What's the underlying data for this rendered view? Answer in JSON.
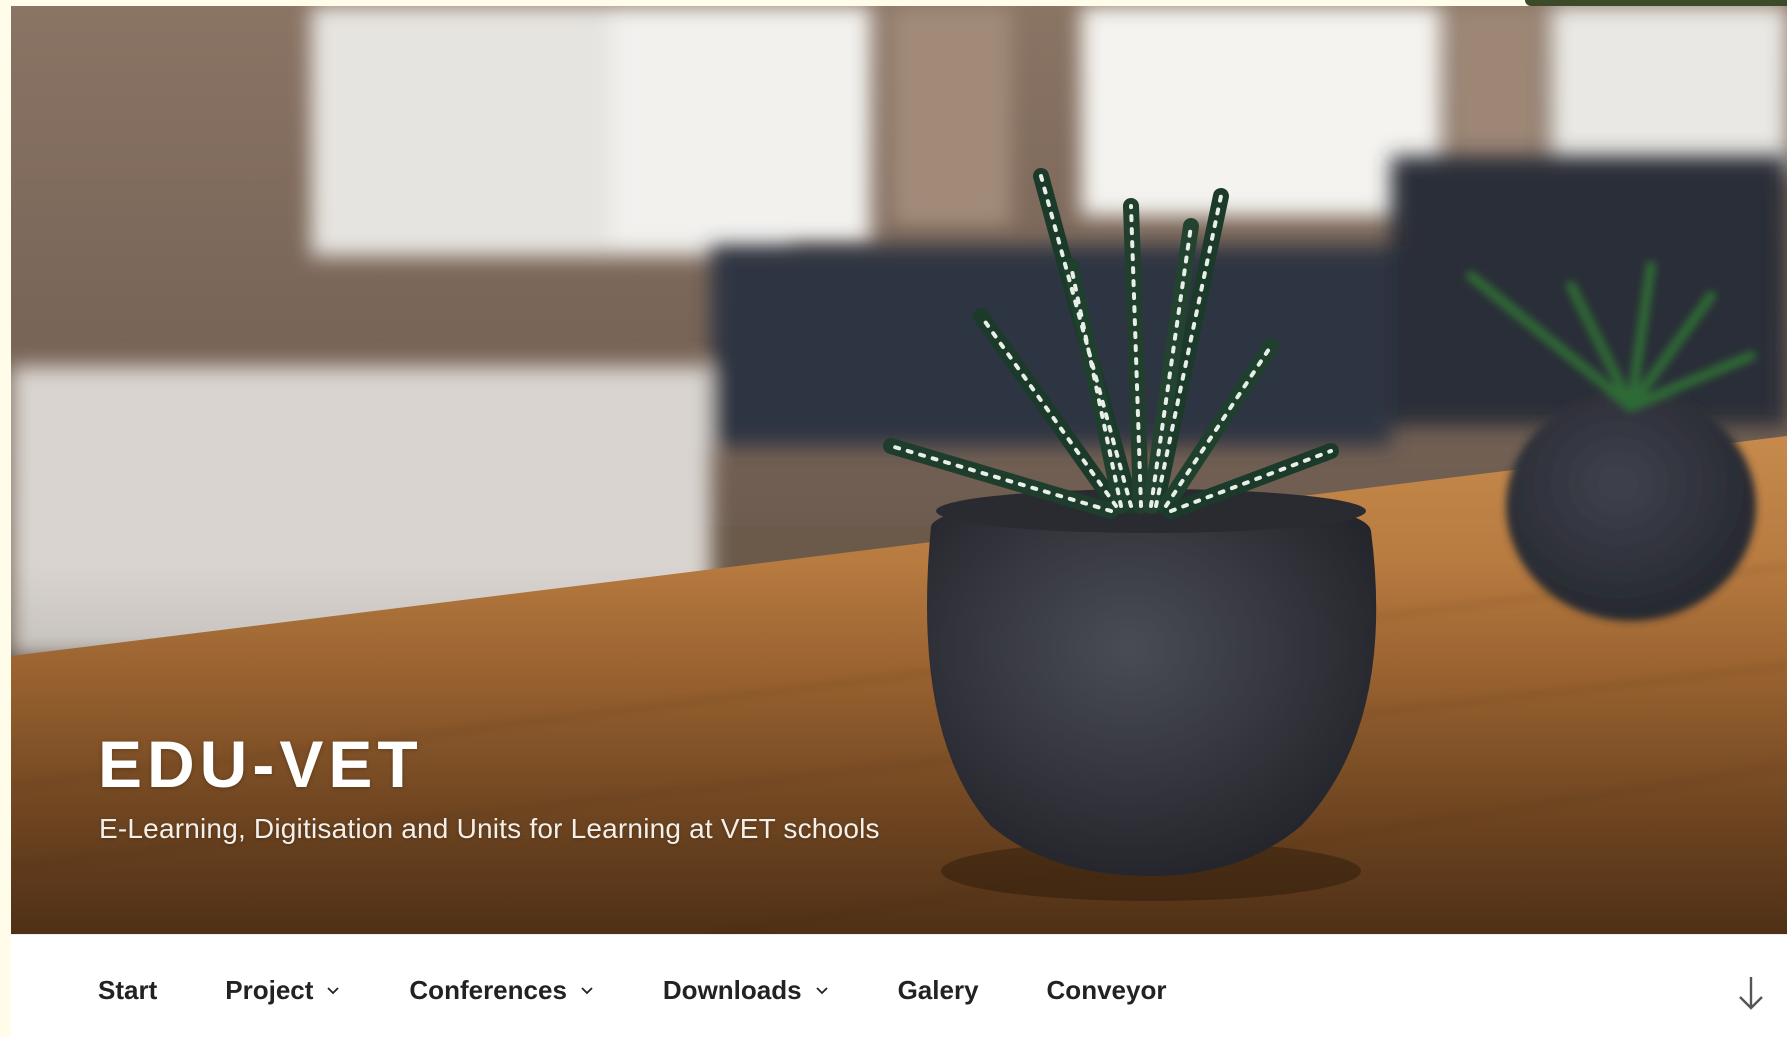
{
  "site": {
    "title": "EDU-VET",
    "tagline": "E-Learning, Digitisation and Units for Learning at VET schools"
  },
  "nav": {
    "items": [
      {
        "label": "Start",
        "has_submenu": false
      },
      {
        "label": "Project",
        "has_submenu": true
      },
      {
        "label": "Conferences",
        "has_submenu": true
      },
      {
        "label": "Downloads",
        "has_submenu": true
      },
      {
        "label": "Galery",
        "has_submenu": false
      },
      {
        "label": "Conveyor",
        "has_submenu": false
      }
    ]
  },
  "icons": {
    "submenu": "chevron-down-icon",
    "scroll": "arrow-down-icon"
  },
  "colors": {
    "nav_text": "#222222",
    "title_text": "#ffffff",
    "background": "#fffde9"
  }
}
